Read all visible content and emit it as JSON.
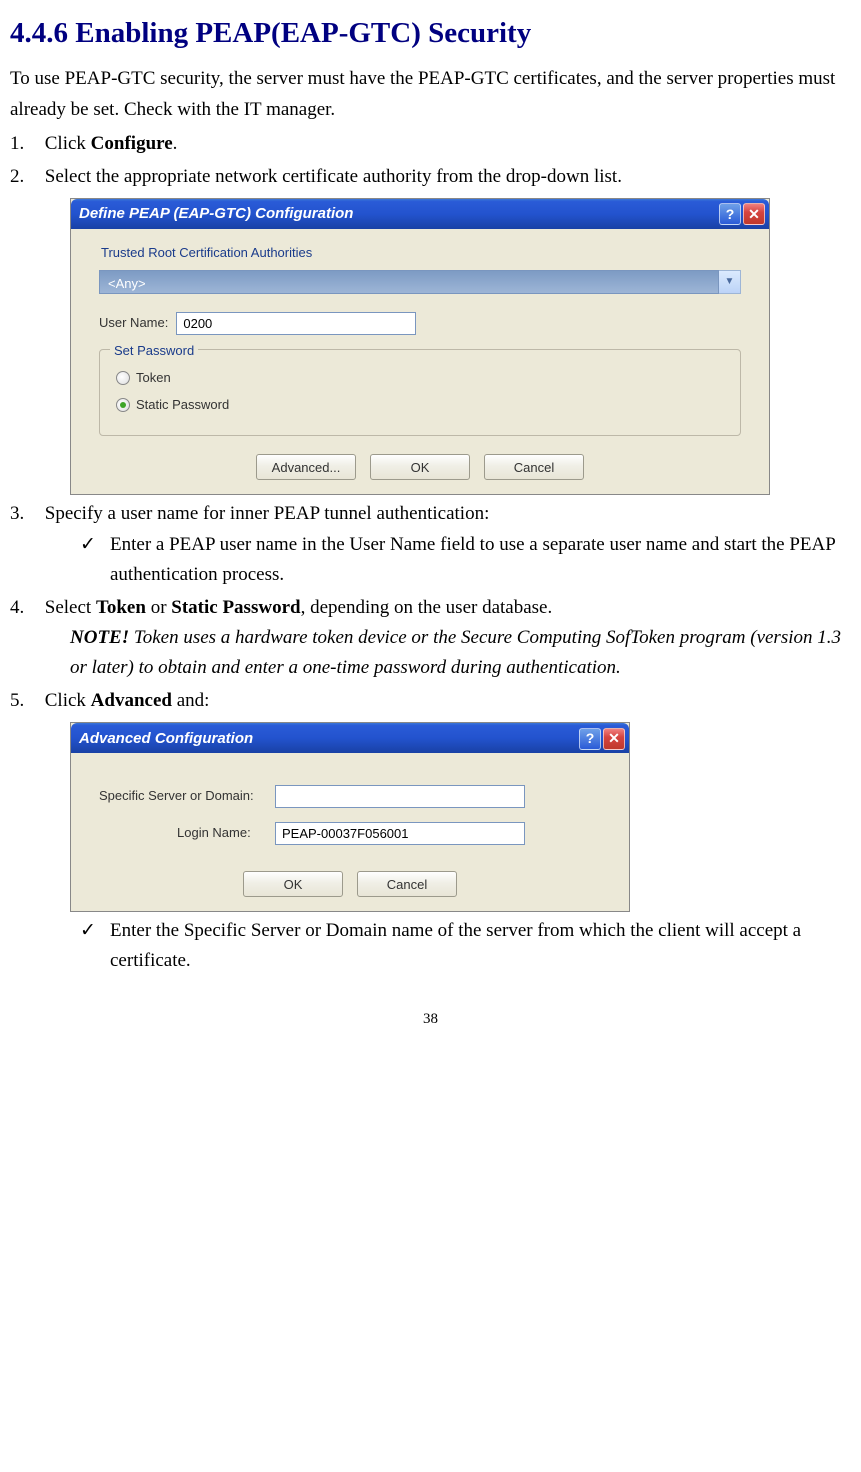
{
  "heading": "4.4.6 Enabling PEAP(EAP-GTC) Security",
  "intro": "To use PEAP-GTC security, the server must have the PEAP-GTC certificates, and the server properties must already be set. Check with the IT manager.",
  "steps": {
    "s1_pre": "Click ",
    "s1_bold": "Configure",
    "s1_post": ".",
    "s2": "Select the appropriate network certificate authority from the drop-down list.",
    "s3": "Specify a user name for inner PEAP tunnel authentication:",
    "s3_sub1": "Enter a PEAP user name in the User Name field to use a separate user name and start the PEAP authentication process.",
    "s4_pre": "Select ",
    "s4_b1": "Token",
    "s4_mid": " or ",
    "s4_b2": "Static Password",
    "s4_post": ", depending on the user database.",
    "note_label": "NOTE!",
    "note_text": "     Token uses a hardware token device or the Secure Computing SofToken program (version 1.3 or later) to obtain and enter a one-time password during authentication.",
    "s5_pre": "Click ",
    "s5_bold": "Advanced",
    "s5_post": " and:",
    "s5_sub1": "Enter the Specific Server or Domain name of the server from which the client will accept a certificate."
  },
  "dialog1": {
    "title": "Define PEAP (EAP-GTC) Configuration",
    "trca_label": "Trusted Root Certification Authorities",
    "trca_value": "<Any>",
    "username_label": "User Name:",
    "username_value": "0200",
    "set_password_legend": "Set Password",
    "radio_token": "Token",
    "radio_static": "Static Password",
    "btn_advanced": "Advanced...",
    "btn_ok": "OK",
    "btn_cancel": "Cancel"
  },
  "dialog2": {
    "title": "Advanced Configuration",
    "server_label": "Specific Server or Domain:",
    "server_value": "",
    "login_label": "Login Name:",
    "login_value": "PEAP-00037F056001",
    "btn_ok": "OK",
    "btn_cancel": "Cancel"
  },
  "page_number": "38"
}
